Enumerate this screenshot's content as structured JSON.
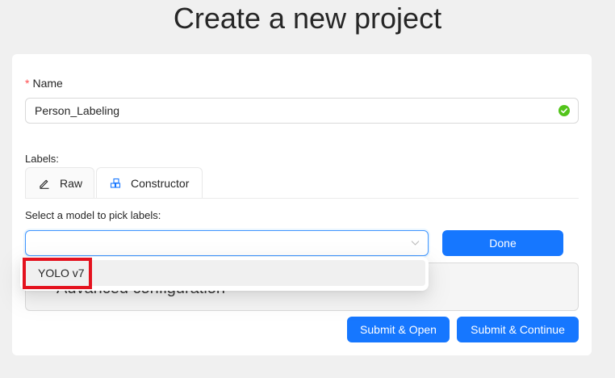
{
  "page": {
    "title": "Create a new project"
  },
  "form": {
    "name_label": "Name",
    "name_required_mark": "*",
    "name_value": "Person_Labeling",
    "labels_label": "Labels:",
    "tabs": [
      {
        "label": "Raw",
        "icon": "edit-icon",
        "active": false
      },
      {
        "label": "Constructor",
        "icon": "blocks-icon",
        "active": true
      }
    ],
    "model_label": "Select a model to pick labels:",
    "model_value": "",
    "done_label": "Done",
    "advanced_label": "Advanced configuration",
    "submit_open_label": "Submit & Open",
    "submit_continue_label": "Submit & Continue"
  },
  "dropdown": {
    "options": [
      {
        "label": "YOLO v7",
        "highlighted": true
      }
    ]
  },
  "colors": {
    "primary": "#1677ff",
    "success": "#52c41a",
    "required": "#ff4d4f",
    "highlight": "#e4121e"
  }
}
